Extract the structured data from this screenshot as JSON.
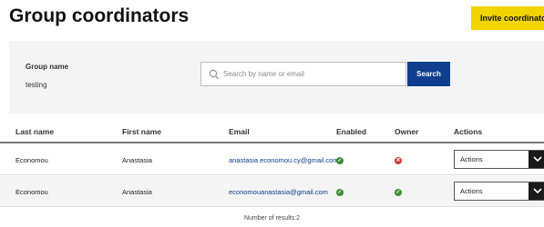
{
  "header": {
    "title": "Group coordinators",
    "invite_label": "Invite coordinator"
  },
  "filter": {
    "group_label": "Group name",
    "group_value": "testing",
    "search_placeholder": "Search by name or email",
    "search_button": "Search"
  },
  "table": {
    "columns": [
      "Last name",
      "First name",
      "Email",
      "Enabled",
      "Owner",
      "Actions"
    ],
    "rows": [
      {
        "last_name": "Economou",
        "first_name": "Anastasia",
        "email": "anastasia.economou.cy@gmail.com",
        "enabled": true,
        "owner": false,
        "actions": "Actions"
      },
      {
        "last_name": "Economou",
        "first_name": "Anastasia",
        "email": "economouanastasia@gmail.com",
        "enabled": true,
        "owner": true,
        "actions": "Actions"
      }
    ]
  },
  "footer": {
    "results": "Number of results:2"
  },
  "colors": {
    "accent_yellow": "#f2d400",
    "primary_blue": "#0e3e8c",
    "enabled_green": "#3e8c35",
    "disabled_red": "#d23c3c"
  },
  "icons": {
    "search": "search-icon",
    "check": "check-icon",
    "cross": "x-icon",
    "dropdown": "chevron-down-icon"
  }
}
